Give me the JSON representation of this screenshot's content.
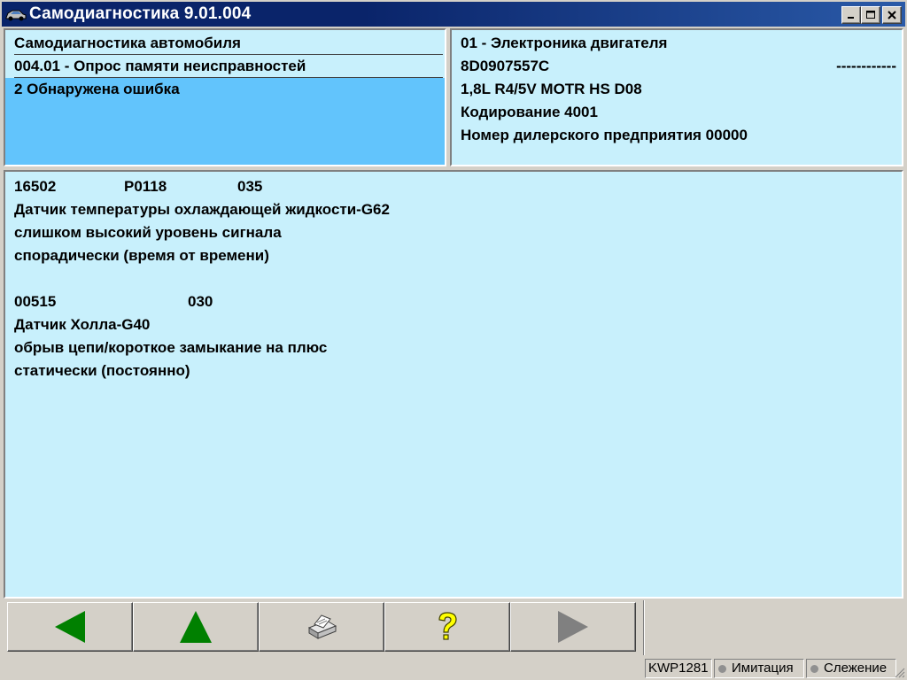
{
  "window": {
    "title": "Самодиагностика 9.01.004"
  },
  "left_panel": {
    "line1": "Самодиагностика автомобиля",
    "line2": "004.01 - Опрос памяти неисправностей",
    "selected": "2 Обнаружена ошибка"
  },
  "right_panel": {
    "line1": "01 - Электроника двигателя",
    "part_number": "8D0907557C",
    "dashes": "------------",
    "engine": "1,8L R4/5V  MOTR HS D08",
    "coding": "Кодирование 4001",
    "dealer": "Номер дилерского предприятия 00000"
  },
  "faults": [
    {
      "code": "16502",
      "pcode": "P0118",
      "status": "035",
      "desc": "Датчик температуры охлаждающей жидкости-G62",
      "detail": "слишком высокий уровень сигнала",
      "mode": "спорадически (время от времени)"
    },
    {
      "code": "00515",
      "pcode": "",
      "status": "030",
      "desc": "Датчик Холла-G40",
      "detail": "обрыв цепи/короткое замыкание на плюс",
      "mode": "статически (постоянно)"
    }
  ],
  "toolbar": {
    "back_icon": "arrow-left-icon",
    "up_icon": "arrow-up-icon",
    "print_icon": "printer-icon",
    "help_icon": "help-icon",
    "forward_icon": "arrow-right-icon",
    "back_color": "#008000",
    "up_color": "#008000",
    "forward_color": "#808080",
    "help_color": "#ffff00"
  },
  "statusbar": {
    "protocol": "KWP1281",
    "simulation": "Имитация",
    "tracking": "Слежение"
  }
}
